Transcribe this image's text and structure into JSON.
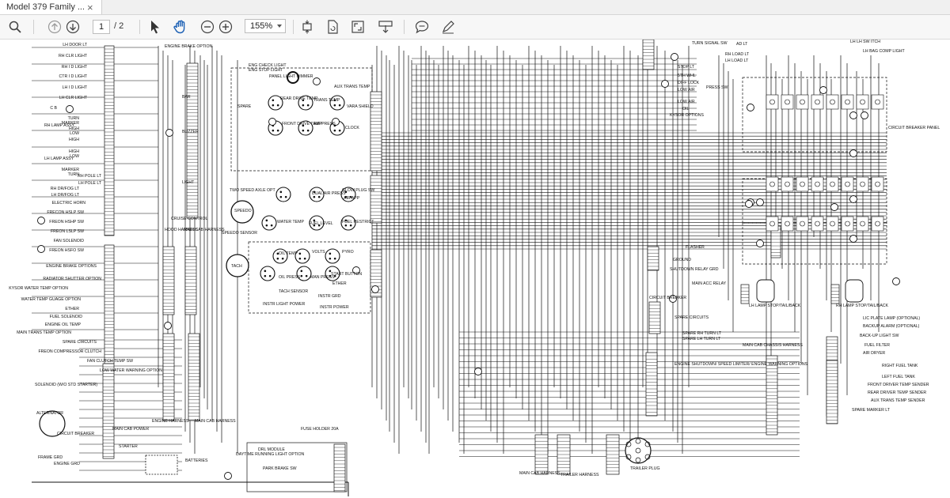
{
  "tab": {
    "title": "Model 379 Family ...",
    "close": "×"
  },
  "toolbar": {
    "current_page": "1",
    "total_pages": "/ 2",
    "zoom": "155%",
    "icons": [
      "search-icon",
      "page-up-icon",
      "page-down-icon",
      "select-cursor-icon",
      "hand-tool-icon",
      "zoom-out-icon",
      "zoom-in-icon",
      "fit-page-icon",
      "rotate-icon",
      "fullscreen-icon",
      "download-icon",
      "comment-icon",
      "draw-icon"
    ]
  },
  "schematic": {
    "left_labels": [
      "LH DOOR LT",
      "RH CLR LIGHT",
      "RH I D LIGHT",
      "CTR I D LIGHT",
      "LH I D LIGHT",
      "LH CLR LIGHT",
      "C B",
      "TURN",
      "MARKER",
      "HIGH",
      "LOW",
      "HIGH",
      "HIGH",
      "LOW",
      "MARKER",
      "TURN",
      "RH POLE LT",
      "LH POLE LT",
      "RH DR/FOG LT",
      "LH DR/FOG LT",
      "ELECTRIC HORN",
      "FRECON HSLP SW",
      "FREON HSHP SW",
      "FREON LSLP SW",
      "FAN SOLENOID",
      "FREON HSFO SW",
      "ENGINE BRAKE OPTIONS",
      "RADIATOR SHUTTER OPTION",
      "KYSOR WATER TEMP OPTION",
      "WATER TEMP GUAGE OPTION",
      "ETHER",
      "FUEL SOLENOID",
      "ENGINE OIL TEMP",
      "MAIN TRANS TEMP OPTION",
      "SPARE CIRCUITS",
      "FREON COMPRESSOR CLUTCH",
      "FAN CLUTCH TEMP SW",
      "LOW WATER WARNING OPTION",
      "SOLENOID (W/O STD STARTER)",
      "ALTERNATOR",
      "CIRCUIT BREAKER",
      "STARTER",
      "FRAME GRD",
      "ENGINE GRD",
      "BATTERIES"
    ],
    "lamp_labels": [
      "RH LAMP ASSY",
      "LH LAMP ASSY"
    ],
    "center_labels": [
      "ENGINE BRAKE OPTION",
      "ENG CHECK LIGHT",
      "ENG STOP LIGHT",
      "PANEL LIGHT DIMMER",
      "AUX TRANS TEMP",
      "SPARE",
      "VARA SHIELD",
      "TRANS TEMP",
      "REAR DRIVE TEMP",
      "FRONT DRIVE TEMP",
      "AIR PRESS",
      "CLOCK",
      "BAR",
      "BUZZER",
      "LIGHT",
      "CRUISE CONTROL",
      "HOOD HARNESS",
      "MAIN CAB HARNESS",
      "TWO SPEED AXLE OPT",
      "SPEEDO",
      "WATER TEMP",
      "FUEL LEVEL",
      "DUAL AIR PRESS",
      "GLOW PLUG SW",
      "AIR APP",
      "FUEL RESTRICT",
      "SPEEDO SENSOR",
      "TACH",
      "OIL TEMP",
      "VOLTS",
      "PYRO",
      "OIL PRESS",
      "MAN PRESS",
      "START BUTTON",
      "ETHER",
      "TACH SENSOR",
      "INSTR GRD",
      "INSTR LIGHT POWER",
      "INSTR POWER",
      "ENGINE HARNESS",
      "MAIN CAB HARNESS",
      "MAIN CAB POWER",
      "FUSE HOLDER 20A",
      "DRL MODULE",
      "DAYTIME RUNNING LIGHT OPTION",
      "PARK BRAKE SW",
      "MAIN CAB HARNESS",
      "TRAILER HARNESS",
      "TRAILER PLUG"
    ],
    "right_labels": [
      "TURN SIGNAL SW",
      "AD LT",
      "RH LOAD LT",
      "LH LOAD LT",
      "LH LH SW ITCH",
      "LH BAG COMP LIGHT",
      "STOP LT",
      "5TH WHL",
      "DIFF LOCK",
      "LOW AIR",
      "PRESS SW",
      "LOW AIR",
      "OIL",
      "KYSOR OPTIONS",
      "CIRCUIT BREAKER PANEL",
      "FLASHER",
      "GROUND",
      "SHUTDOWN RELAY GRD",
      "MAIN ACC RELAY",
      "CIRCUIT BREAKER",
      "SPARE CIRCUITS",
      "SPARE RH TURN LT",
      "SPARE LH TURN LT",
      "LH LAMP STOP/TAIL/BACK",
      "RH LAMP STOP/TAIL/BACK",
      "LIC PLATE LAMP (OPTIONAL)",
      "BACKUP ALARM (OPTIONAL)",
      "BACK-UP LIGHT SW",
      "FUEL FILTER",
      "AIR DRYER",
      "MAIN CAB CHASSIS HARNESS",
      "ENGINE SHUTDOWN/ SPEED LIMITER/ ENGINE WARNING OPTIONS",
      "RIGHT FUEL TANK",
      "LEFT FUEL TANK",
      "FRONT DRIVER TEMP SENDER",
      "REAR DRIVER TEMP SENDER",
      "AUX TRANS TEMP SENDER",
      "SPARE MARKER LT"
    ]
  }
}
